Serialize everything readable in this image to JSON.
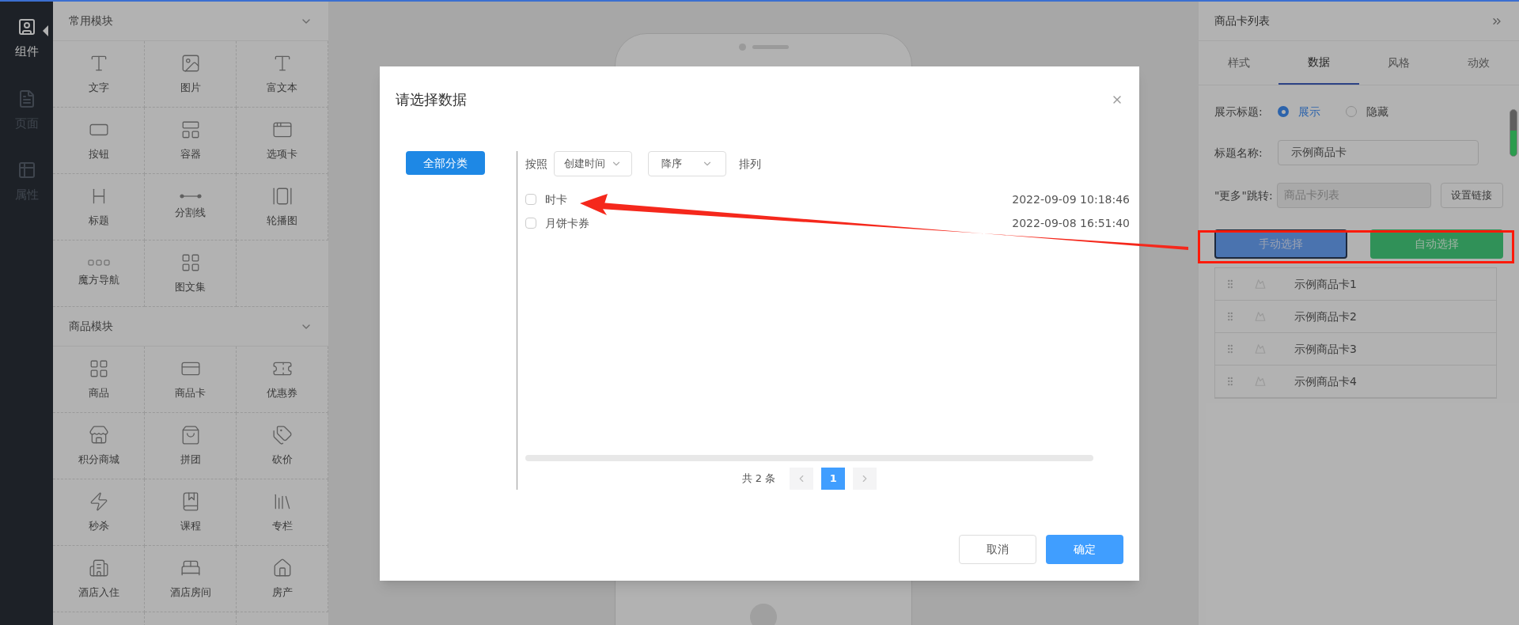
{
  "nav": [
    {
      "label": "组件",
      "selected": true
    },
    {
      "label": "页面",
      "selected": false
    },
    {
      "label": "属性",
      "selected": false
    }
  ],
  "component_panel": {
    "sections": [
      {
        "title": "常用模块",
        "items": [
          {
            "label": "文字"
          },
          {
            "label": "图片"
          },
          {
            "label": "富文本"
          },
          {
            "label": "按钮"
          },
          {
            "label": "容器"
          },
          {
            "label": "选项卡"
          },
          {
            "label": "标题"
          },
          {
            "label": "分割线"
          },
          {
            "label": "轮播图"
          },
          {
            "label": "魔方导航"
          },
          {
            "label": "图文集"
          }
        ]
      },
      {
        "title": "商品模块",
        "items": [
          {
            "label": "商品"
          },
          {
            "label": "商品卡"
          },
          {
            "label": "优惠券"
          },
          {
            "label": "积分商城"
          },
          {
            "label": "拼团"
          },
          {
            "label": "砍价"
          },
          {
            "label": "秒杀"
          },
          {
            "label": "课程"
          },
          {
            "label": "专栏"
          },
          {
            "label": "酒店入住"
          },
          {
            "label": "酒店房间"
          },
          {
            "label": "房产"
          }
        ]
      }
    ]
  },
  "settings_panel": {
    "title": "商品卡列表",
    "tabs": [
      {
        "label": "样式",
        "selected": false
      },
      {
        "label": "数据",
        "selected": true
      },
      {
        "label": "风格",
        "selected": false
      },
      {
        "label": "动效",
        "selected": false
      }
    ],
    "show_title": {
      "label": "展示标题:",
      "options": [
        {
          "label": "展示",
          "selected": true
        },
        {
          "label": "隐藏",
          "selected": false
        }
      ]
    },
    "title_name": {
      "label": "标题名称:",
      "value": "示例商品卡"
    },
    "more_link": {
      "label": "\"更多\"跳转:",
      "value": "商品卡列表",
      "disabled": true,
      "button": "设置链接"
    },
    "select_buttons": [
      {
        "label": "手动选择",
        "kind": "manual"
      },
      {
        "label": "自动选择",
        "kind": "auto"
      }
    ],
    "goods": [
      {
        "label": "示例商品卡1"
      },
      {
        "label": "示例商品卡2"
      },
      {
        "label": "示例商品卡3"
      },
      {
        "label": "示例商品卡4"
      }
    ]
  },
  "dialog": {
    "title": "请选择数据",
    "category_button": "全部分类",
    "sort": {
      "prefix": "按照",
      "field": "创建时间",
      "order": "降序",
      "suffix": "排列"
    },
    "rows": [
      {
        "name": "时卡",
        "time": "2022-09-09 10:18:46",
        "checked": false
      },
      {
        "name": "月饼卡券",
        "time": "2022-09-08 16:51:40",
        "checked": false
      }
    ],
    "pagination": {
      "total": "共 2 条",
      "pages": [
        {
          "label": "1",
          "selected": true
        }
      ]
    },
    "buttons": [
      {
        "label": "取消",
        "kind": "cancel"
      },
      {
        "label": "确定",
        "kind": "confirm"
      }
    ]
  }
}
